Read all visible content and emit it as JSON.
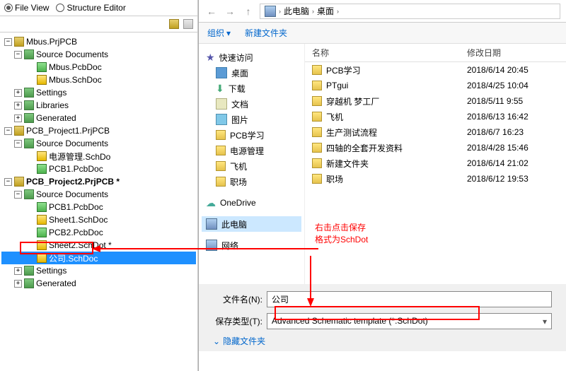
{
  "view_toggle": {
    "file_view": "File View",
    "structure_editor": "Structure Editor"
  },
  "tree": {
    "proj1": "Mbus.PrjPCB",
    "srcdocs": "Source Documents",
    "mbus_pcb": "Mbus.PcbDoc",
    "mbus_sch": "Mbus.SchDoc",
    "settings": "Settings",
    "libraries": "Libraries",
    "generated": "Generated",
    "proj2": "PCB_Project1.PrjPCB",
    "psu_sch": "电源管理.SchDo",
    "pcb1": "PCB1.PcbDoc",
    "proj3": "PCB_Project2.PrjPCB *",
    "sheet1": "Sheet1.SchDoc",
    "pcb2": "PCB2.PcbDoc",
    "sheet2": "Sheet2.SchDot *",
    "company": "公司.SchDoc"
  },
  "addr": {
    "this_pc": "此电脑",
    "desktop": "桌面"
  },
  "cmd": {
    "organize": "组织",
    "new_folder": "新建文件夹"
  },
  "nav": {
    "quick": "快速访问",
    "desktop": "桌面",
    "downloads": "下载",
    "documents": "文档",
    "pictures": "图片",
    "pcb_learn": "PCB学习",
    "psu": "电源管理",
    "plane": "飞机",
    "work": "职场",
    "onedrive": "OneDrive",
    "this_pc": "此电脑",
    "network": "网络"
  },
  "cols": {
    "name": "名称",
    "date": "修改日期"
  },
  "files": [
    {
      "name": "PCB学习",
      "date": "2018/6/14 20:45"
    },
    {
      "name": "PTgui",
      "date": "2018/4/25 10:04"
    },
    {
      "name": "穿越机 梦工厂",
      "date": "2018/5/11 9:55"
    },
    {
      "name": "飞机",
      "date": "2018/6/13 16:42"
    },
    {
      "name": "生产测试流程",
      "date": "2018/6/7 16:23"
    },
    {
      "name": "四轴的全套开发资料",
      "date": "2018/4/28 15:46"
    },
    {
      "name": "新建文件夹",
      "date": "2018/6/14 21:02"
    },
    {
      "name": "职场",
      "date": "2018/6/12 19:53"
    }
  ],
  "form": {
    "filename_label": "文件名(N):",
    "filename_value": "公司",
    "filetype_label": "保存类型(T):",
    "filetype_value": "Advanced Schematic template (*.SchDot)",
    "hide": "隐藏文件夹"
  },
  "annotation": {
    "line1": "右击点击保存",
    "line2": "格式为SchDot"
  }
}
